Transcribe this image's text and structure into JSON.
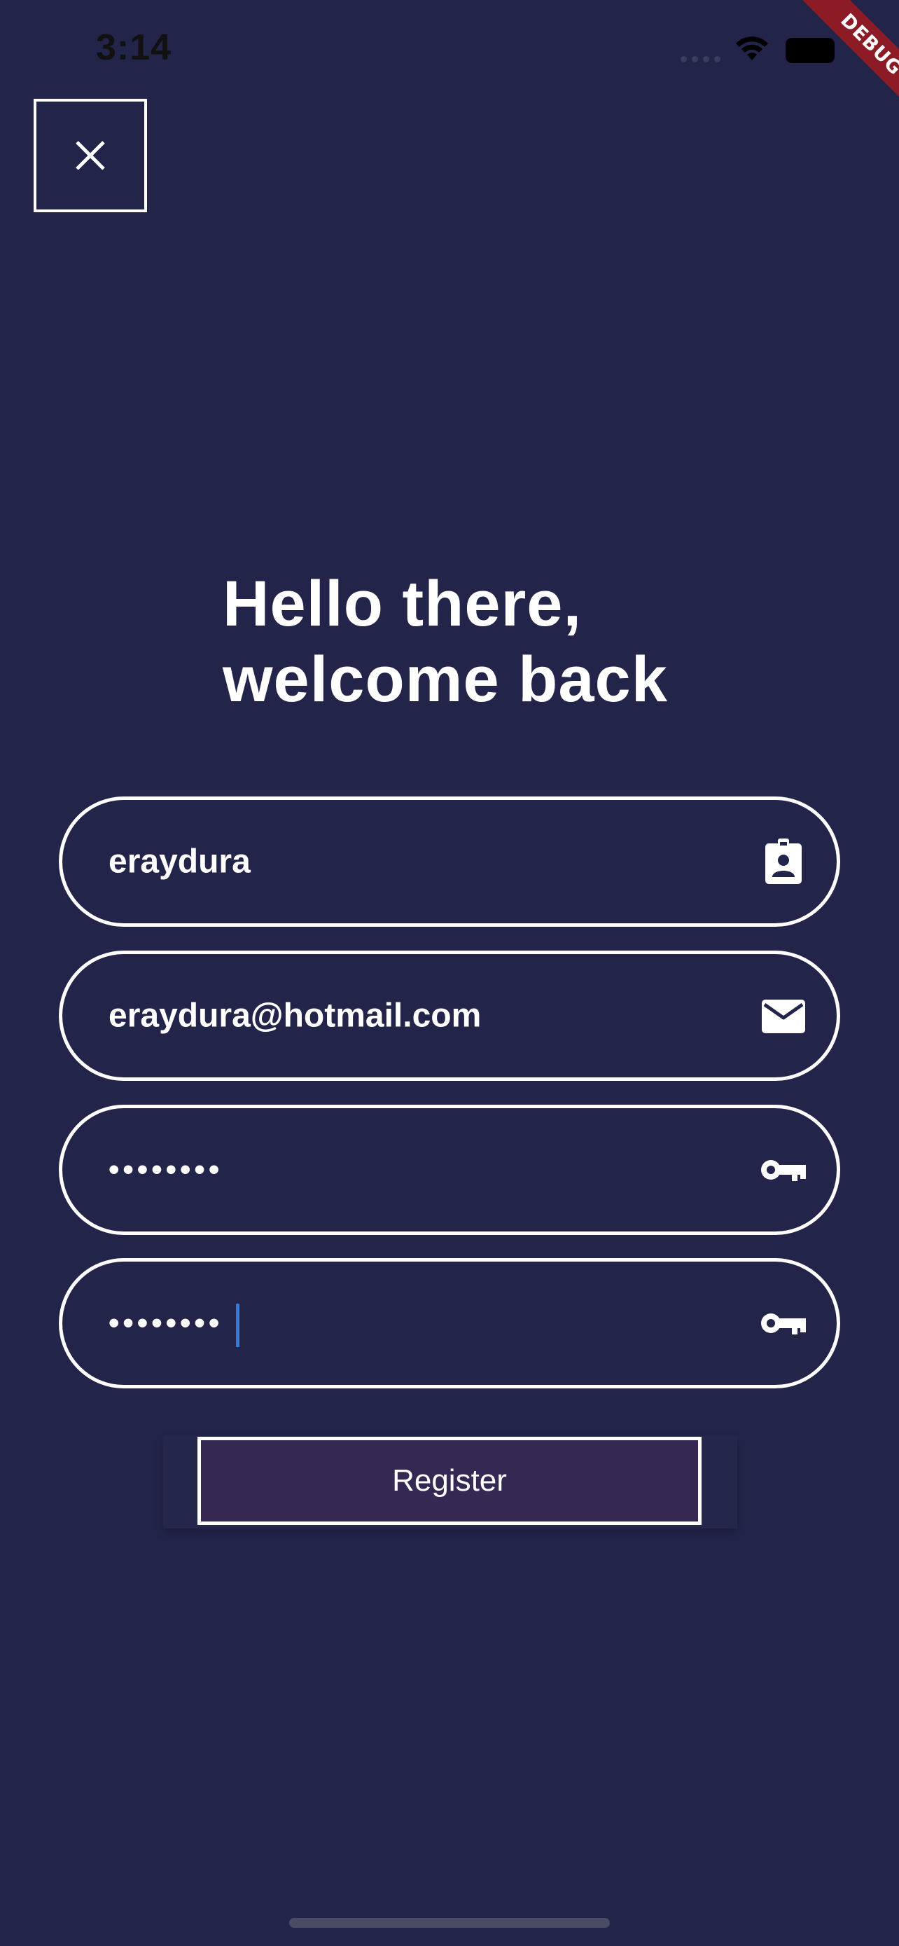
{
  "status_bar": {
    "time": "3:14"
  },
  "debug_banner": {
    "label": "DEBUG",
    "color": "#8c1b25"
  },
  "close_button": {
    "icon": "close-icon"
  },
  "headline": {
    "line1": "Hello there,",
    "line2": "welcome back"
  },
  "form": {
    "username": {
      "value": "eraydura",
      "icon": "contact-badge-icon"
    },
    "email": {
      "value": "eraydura@hotmail.com",
      "icon": "mail-icon"
    },
    "password": {
      "value": "••••••••",
      "icon": "key-icon"
    },
    "confirm_password": {
      "value": "••••••••",
      "icon": "key-icon"
    }
  },
  "register_button": {
    "label": "Register"
  },
  "colors": {
    "background": "#22244a",
    "button_fill": "#352852",
    "caret": "#2f7de1"
  }
}
